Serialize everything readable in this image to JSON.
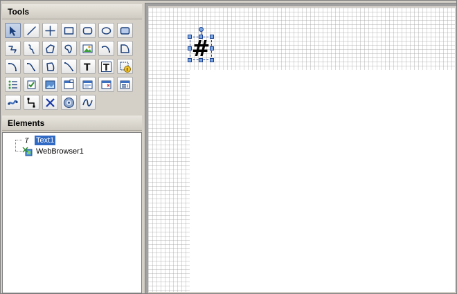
{
  "panels": {
    "tools_title": "Tools",
    "elements_title": "Elements"
  },
  "tools": [
    {
      "name": "pointer-tool",
      "icon": "pointer-arrow-icon",
      "active": true
    },
    {
      "name": "line-tool",
      "icon": "line-icon"
    },
    {
      "name": "cross-tool",
      "icon": "cross-icon"
    },
    {
      "name": "rectangle-tool",
      "icon": "rectangle-icon"
    },
    {
      "name": "rounded-rectangle-tool",
      "icon": "rounded-rectangle-icon"
    },
    {
      "name": "ellipse-tool",
      "icon": "ellipse-icon"
    },
    {
      "name": "filled-rounded-rectangle-tool",
      "icon": "filled-rounded-rectangle-icon"
    },
    {
      "name": "polyline-tool",
      "icon": "polyline-icon"
    },
    {
      "name": "freehand-tool",
      "icon": "freehand-curve-icon"
    },
    {
      "name": "polygon-tool",
      "icon": "polygon-icon"
    },
    {
      "name": "closed-curve-tool",
      "icon": "closed-curve-icon"
    },
    {
      "name": "image-tool",
      "icon": "image-icon"
    },
    {
      "name": "arc-tool",
      "icon": "arc-icon"
    },
    {
      "name": "pie-tool",
      "icon": "pie-icon"
    },
    {
      "name": "bezier-tool",
      "icon": "bezier-icon"
    },
    {
      "name": "curve-tool",
      "icon": "curve-icon"
    },
    {
      "name": "closed-polygon-tool",
      "icon": "closed-polygon-icon"
    },
    {
      "name": "spline-tool",
      "icon": "spline-icon"
    },
    {
      "name": "text-tool",
      "icon": "text-icon"
    },
    {
      "name": "textbox-tool",
      "icon": "textbox-icon"
    },
    {
      "name": "warning-tool",
      "icon": "warning-icon"
    },
    {
      "name": "list-tool",
      "icon": "list-icon"
    },
    {
      "name": "checkbox-tool",
      "icon": "checkbox-icon"
    },
    {
      "name": "picture-box-tool",
      "icon": "picture-box-icon"
    },
    {
      "name": "window-tool",
      "icon": "window-icon"
    },
    {
      "name": "dialog-tool",
      "icon": "dialog-icon"
    },
    {
      "name": "form-tool",
      "icon": "form-icon"
    },
    {
      "name": "panel-tool",
      "icon": "panel-icon"
    },
    {
      "name": "wave-tool",
      "icon": "wave-icon"
    },
    {
      "name": "connector-tool",
      "icon": "connector-icon"
    },
    {
      "name": "x-mark-tool",
      "icon": "x-mark-icon"
    },
    {
      "name": "media-tool",
      "icon": "media-disc-icon"
    },
    {
      "name": "sine-wave-tool",
      "icon": "sine-wave-icon"
    }
  ],
  "elements": [
    {
      "label": "Text1",
      "icon": "text-element-icon",
      "selected": true
    },
    {
      "label": "WebBrowser1",
      "icon": "web-browser-icon",
      "selected": false
    }
  ],
  "canvas": {
    "selected_glyph": "#"
  },
  "colors": {
    "accent_selection": "#316ac5",
    "handle_fill": "#7aa7e0",
    "handle_stroke": "#1a3d8f"
  }
}
